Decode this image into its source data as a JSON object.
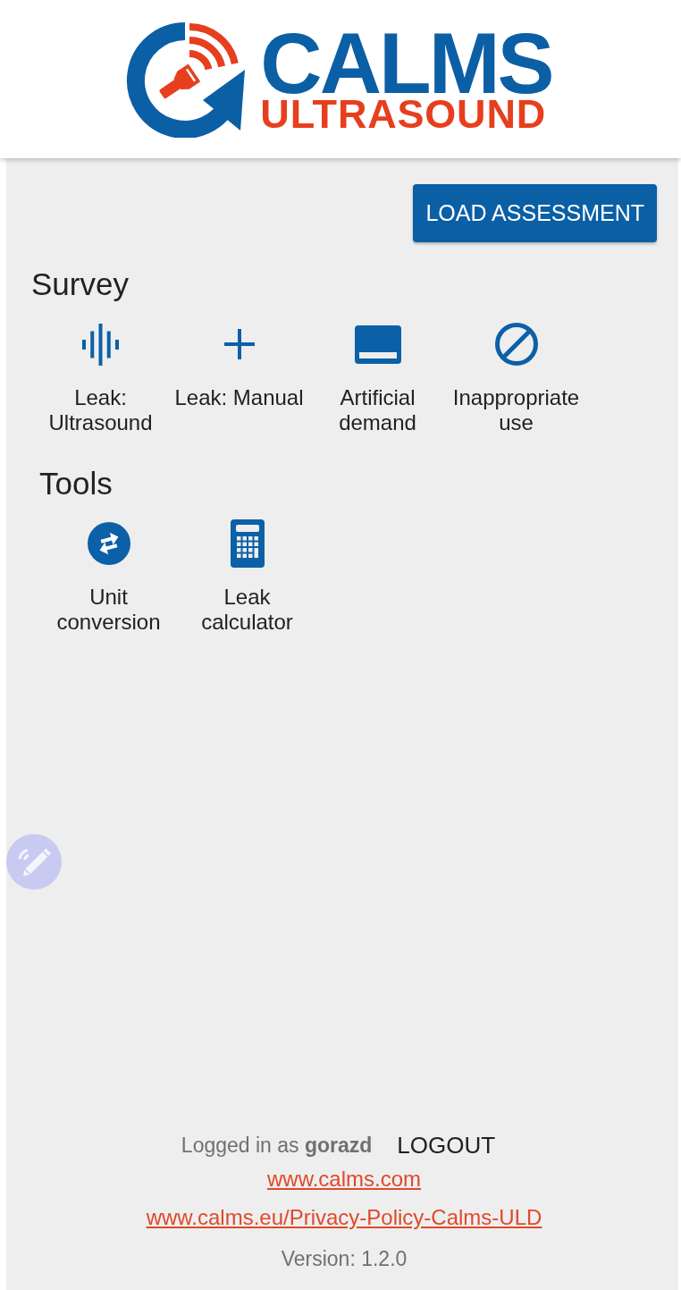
{
  "header": {
    "logo_title": "CALMS",
    "logo_subtitle": "ULTRASOUND"
  },
  "toolbar": {
    "load_button": "LOAD ASSESSMENT"
  },
  "sections": [
    {
      "title": "Survey",
      "items": [
        {
          "kind": "ultrasound",
          "label": "Leak: Ultrasound"
        },
        {
          "kind": "manual",
          "label": "Leak: Manual"
        },
        {
          "kind": "demand",
          "label": "Artificial demand"
        },
        {
          "kind": "misuse",
          "label": "Inappropriate use"
        }
      ]
    },
    {
      "title": "Tools",
      "items": [
        {
          "kind": "conversion",
          "label": "Unit conversion"
        },
        {
          "kind": "calculator",
          "label": "Leak calculator"
        }
      ]
    }
  ],
  "footer": {
    "logged_in": "Logged in as **gorazd**",
    "logout_button": "LOGOUT",
    "links": [
      "www.calms.com",
      "www.calms.eu/Privacy-Policy-Calms-ULD"
    ],
    "version": "Version: 1.2.0"
  }
}
